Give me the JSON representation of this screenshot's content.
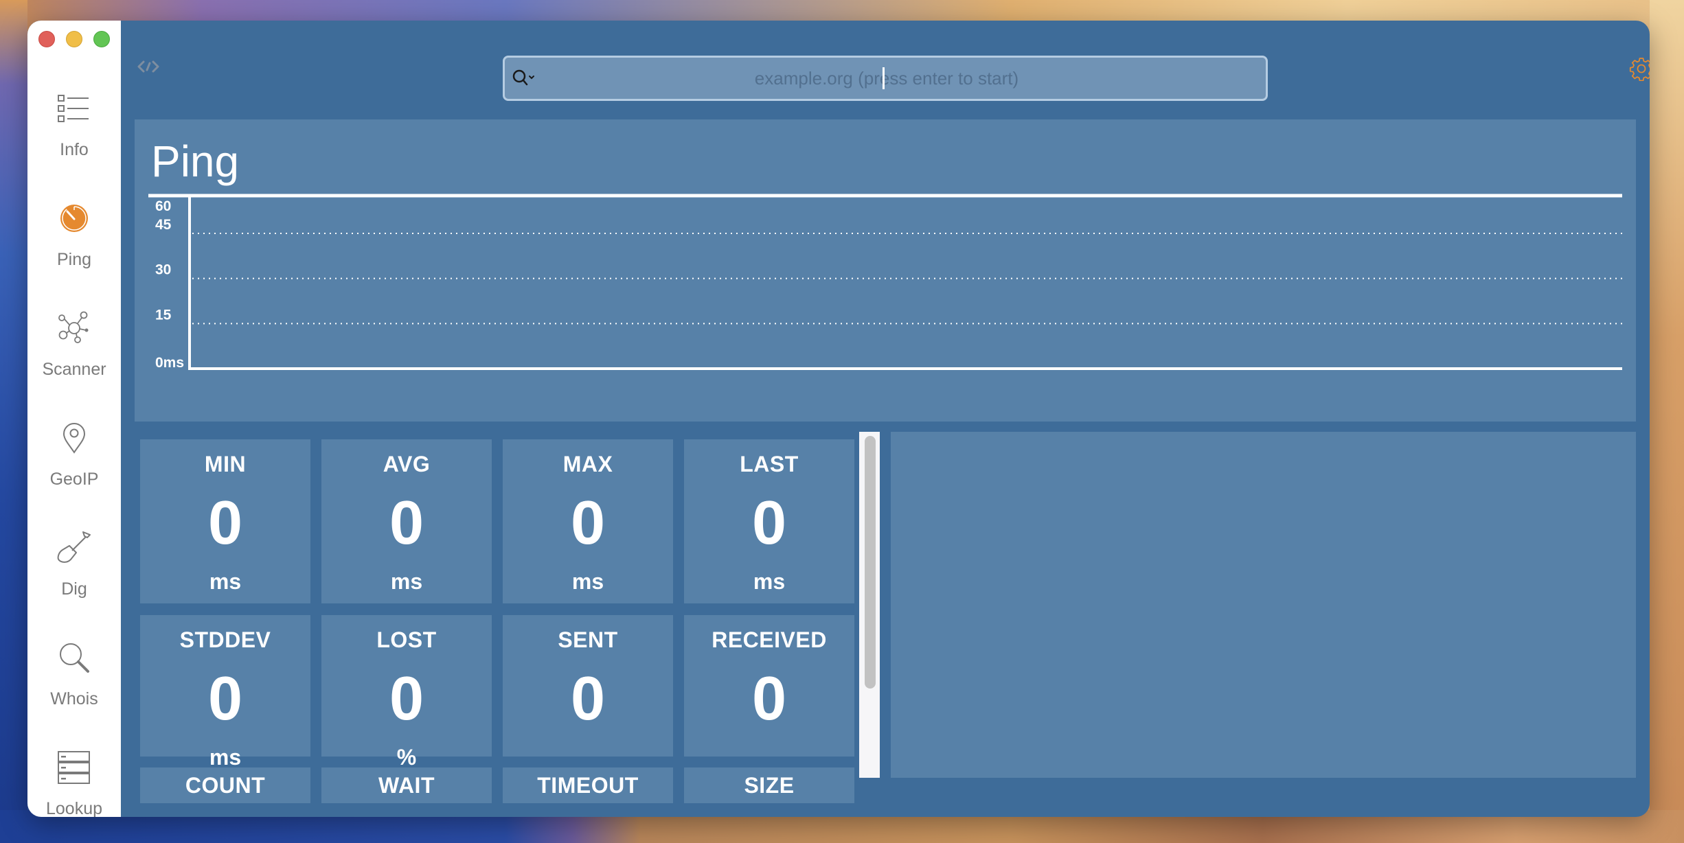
{
  "window": {
    "controls": [
      "close",
      "minimize",
      "zoom"
    ]
  },
  "sidebar": {
    "items": [
      {
        "id": "info",
        "label": "Info",
        "icon": "list-icon",
        "active": false
      },
      {
        "id": "ping",
        "label": "Ping",
        "icon": "stopwatch-icon",
        "active": true
      },
      {
        "id": "scanner",
        "label": "Scanner",
        "icon": "network-nodes-icon",
        "active": false
      },
      {
        "id": "geoip",
        "label": "GeoIP",
        "icon": "map-pin-icon",
        "active": false
      },
      {
        "id": "dig",
        "label": "Dig",
        "icon": "shovel-icon",
        "active": false
      },
      {
        "id": "whois",
        "label": "Whois",
        "icon": "magnifier-icon",
        "active": false
      },
      {
        "id": "lookup",
        "label": "Lookup",
        "icon": "server-stack-icon",
        "active": false
      }
    ]
  },
  "toolbar": {
    "left_icon": "code-icon",
    "search": {
      "value": "",
      "placeholder": "example.org (press enter to start)",
      "icon": "search-icon"
    },
    "right_icon": "gear-icon"
  },
  "colors": {
    "accent": "#e5892f",
    "window_bg": "#3e6c99",
    "panel_bg": "#5781a8",
    "search_bg": "#7093b5",
    "text": "#ffffff",
    "sidebar_text": "#7a7a7a"
  },
  "chart_data": {
    "type": "line",
    "title": "Ping",
    "xlabel": "",
    "ylabel": "",
    "y_ticks": [
      "0ms",
      "15",
      "30",
      "45",
      "60"
    ],
    "y_tick_values": [
      0,
      15,
      30,
      45,
      60
    ],
    "ylim": [
      0,
      60
    ],
    "grid": "dotted-horizontal",
    "series": [
      {
        "name": "ping",
        "values": []
      }
    ]
  },
  "stats": {
    "rows": [
      [
        {
          "label": "MIN",
          "value": "0",
          "unit": "ms"
        },
        {
          "label": "AVG",
          "value": "0",
          "unit": "ms"
        },
        {
          "label": "MAX",
          "value": "0",
          "unit": "ms"
        },
        {
          "label": "LAST",
          "value": "0",
          "unit": "ms"
        }
      ],
      [
        {
          "label": "STDDEV",
          "value": "0",
          "unit": "ms"
        },
        {
          "label": "LOST",
          "value": "0",
          "unit": "%"
        },
        {
          "label": "SENT",
          "value": "0",
          "unit": ""
        },
        {
          "label": "RECEIVED",
          "value": "0",
          "unit": ""
        }
      ],
      [
        {
          "label": "COUNT"
        },
        {
          "label": "WAIT"
        },
        {
          "label": "TIMEOUT"
        },
        {
          "label": "SIZE"
        }
      ]
    ]
  },
  "output": {
    "text": ""
  }
}
